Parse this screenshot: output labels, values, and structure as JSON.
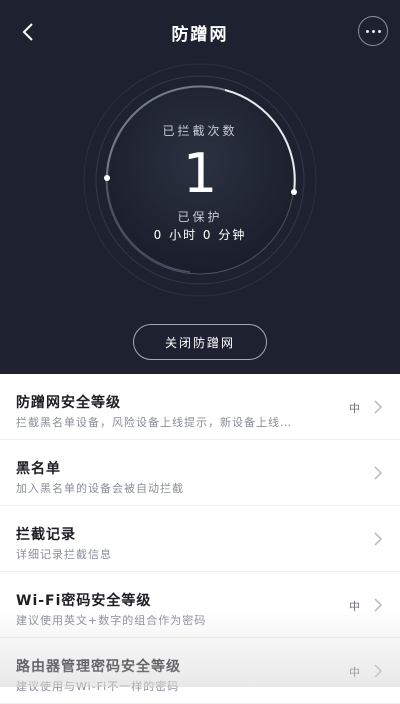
{
  "header": {
    "title": "防蹭网"
  },
  "hero": {
    "blocked_label": "已拦截次数",
    "blocked_count": "1",
    "protected_label": "已保护",
    "protected_time": "0 小时 0 分钟",
    "close_button": "关闭防蹭网"
  },
  "list": [
    {
      "title": "防蹭网安全等级",
      "subtitle": "拦截黑名单设备，风险设备上线提示，新设备上线…",
      "level": "中"
    },
    {
      "title": "黑名单",
      "subtitle": "加入黑名单的设备会被自动拦截",
      "level": ""
    },
    {
      "title": "拦截记录",
      "subtitle": "详细记录拦截信息",
      "level": ""
    },
    {
      "title": "Wi-Fi密码安全等级",
      "subtitle": "建议使用英文+数字的组合作为密码",
      "level": "中"
    },
    {
      "title": "路由器管理密码安全等级",
      "subtitle": "建议使用与Wi-Fi不一样的密码",
      "level": "中"
    }
  ],
  "colors": {
    "hero_bg": "#1e2230",
    "accent": "#ffffff"
  },
  "icons": {
    "back": "chevron-left-icon",
    "more": "more-dots-icon",
    "row_arrow": "chevron-right-icon"
  }
}
